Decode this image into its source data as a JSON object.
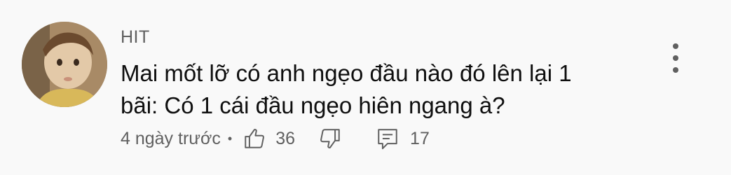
{
  "comment": {
    "author": "HIT",
    "text_line1": "Mai mốt lỡ có anh ngẹo đầu nào đó lên lại 1",
    "text_line2": "bãi: Có 1 cái đầu ngẹo hiên ngang à?",
    "timestamp": "4 ngày trước",
    "separator": "•",
    "like_count": "36",
    "reply_count": "17"
  },
  "icons": {
    "menu": "more-vert-icon",
    "like": "thumb-up-icon",
    "dislike": "thumb-down-icon",
    "reply": "comment-icon"
  },
  "colors": {
    "background": "#f9f9f9",
    "text": "#0f0f0f",
    "secondary": "#606060"
  }
}
